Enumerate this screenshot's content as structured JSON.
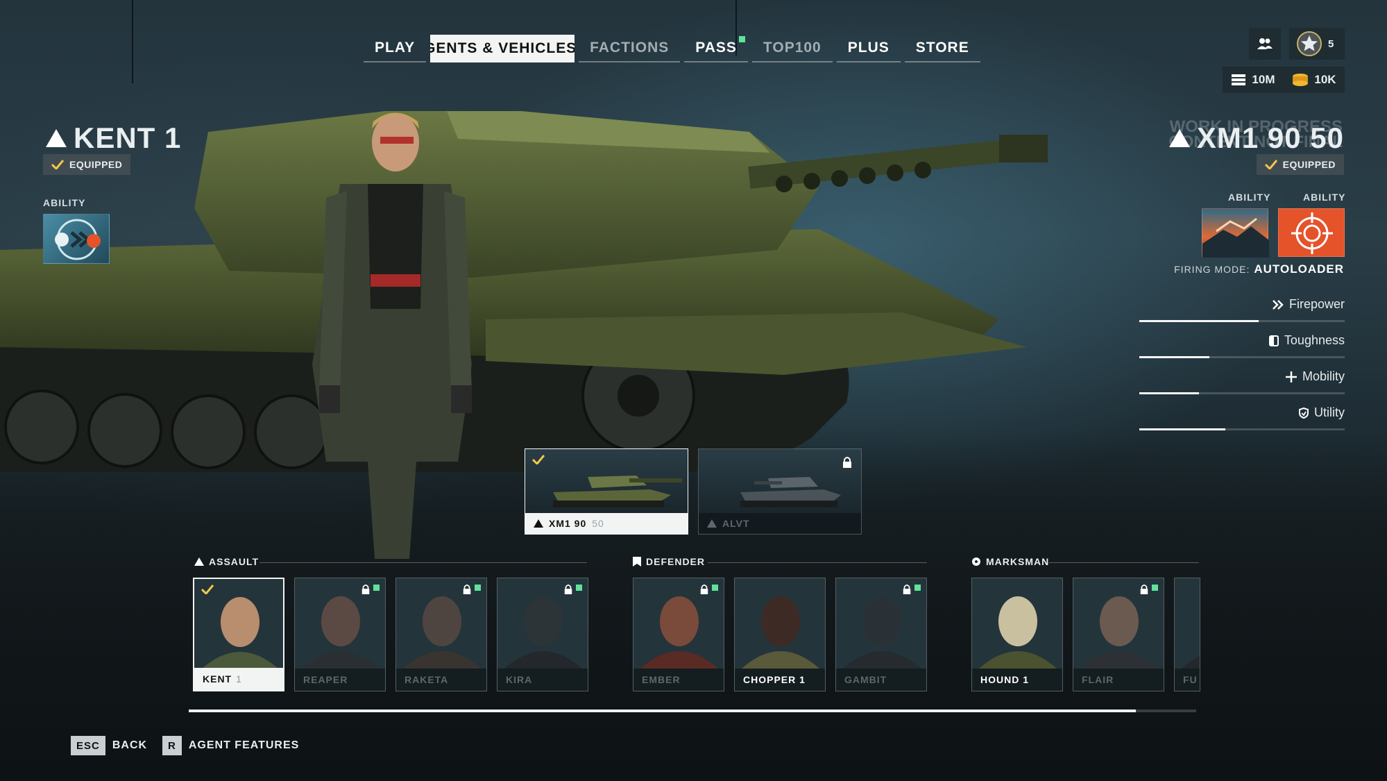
{
  "nav": {
    "tabs": [
      {
        "label": "PLAY",
        "state": "normal"
      },
      {
        "label": "AGENTS & VEHICLES",
        "state": "active"
      },
      {
        "label": "FACTIONS",
        "state": "dim"
      },
      {
        "label": "PASS",
        "state": "normal",
        "notification": true
      },
      {
        "label": "TOP100",
        "state": "dim"
      },
      {
        "label": "PLUS",
        "state": "normal"
      },
      {
        "label": "STORE",
        "state": "normal"
      }
    ]
  },
  "header": {
    "friends_icon": "friends-icon",
    "rank_level": "5",
    "currency_1": "10M",
    "currency_2": "10K"
  },
  "agent": {
    "name": "KENT 1",
    "equipped_label": "EQUIPPED",
    "ability_label": "ABILITY",
    "ability_icon": "skull-dash-ability-icon"
  },
  "vehicle": {
    "name": "XM1 90 50",
    "watermark_line1": "WORK IN PROGRESS",
    "watermark_line2": "CONTENT NOT FINAL",
    "equipped_label": "EQUIPPED",
    "ability_label_1": "ABILITY",
    "ability_label_2": "ABILITY",
    "firing_mode_label": "FIRING MODE:",
    "firing_mode_value": "AUTOLOADER",
    "stats": [
      {
        "label": "Firepower",
        "icon": "chevrons-icon",
        "value": 0.58
      },
      {
        "label": "Toughness",
        "icon": "shield-half-icon",
        "value": 0.34
      },
      {
        "label": "Mobility",
        "icon": "cross-arrows-icon",
        "value": 0.29
      },
      {
        "label": "Utility",
        "icon": "shield-utility-icon",
        "value": 0.42
      }
    ]
  },
  "vehicle_cards": [
    {
      "name": "XM1 90",
      "level": "50",
      "selected": true,
      "locked": false
    },
    {
      "name": "ALVT",
      "level": "",
      "selected": false,
      "locked": true
    }
  ],
  "roster": {
    "groups": [
      {
        "label": "ASSAULT",
        "icon": "triangle-icon"
      },
      {
        "label": "DEFENDER",
        "icon": "bookmark-icon"
      },
      {
        "label": "MARKSMAN",
        "icon": "crosshair-dot-icon"
      }
    ],
    "agents": [
      {
        "name": "KENT",
        "level": "1",
        "owned": true,
        "selected": true,
        "locked": false
      },
      {
        "name": "REAPER",
        "level": "",
        "owned": false,
        "selected": false,
        "locked": true
      },
      {
        "name": "RAKETA",
        "level": "",
        "owned": false,
        "selected": false,
        "locked": true
      },
      {
        "name": "KIRA",
        "level": "",
        "owned": false,
        "selected": false,
        "locked": true
      },
      {
        "name": "EMBER",
        "level": "",
        "owned": false,
        "selected": false,
        "locked": true
      },
      {
        "name": "CHOPPER 1",
        "level": "",
        "owned": true,
        "selected": false,
        "locked": false
      },
      {
        "name": "GAMBIT",
        "level": "",
        "owned": false,
        "selected": false,
        "locked": true
      },
      {
        "name": "HOUND 1",
        "level": "",
        "owned": true,
        "selected": false,
        "locked": false
      },
      {
        "name": "FLAIR",
        "level": "",
        "owned": false,
        "selected": false,
        "locked": true
      },
      {
        "name": "FU",
        "level": "",
        "owned": false,
        "selected": false,
        "locked": false
      }
    ],
    "scroll_position": 0.94
  },
  "footer": {
    "back_key": "ESC",
    "back_label": "BACK",
    "features_key": "R",
    "features_label": "AGENT FEATURES"
  },
  "colors": {
    "accent_green": "#5fe39a",
    "check_yellow": "#f2c94c",
    "ability_orange": "#e5532a"
  }
}
